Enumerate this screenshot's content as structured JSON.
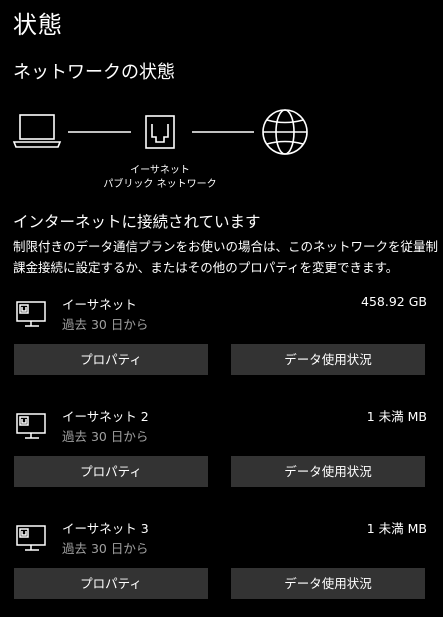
{
  "page": {
    "title": "状態",
    "section_title": "ネットワークの状態"
  },
  "diagram": {
    "adapter_label_line1": "イーサネット",
    "adapter_label_line2": "パブリック ネットワーク",
    "icons": [
      "laptop-icon",
      "ethernet-port-icon",
      "globe-icon"
    ]
  },
  "status": {
    "heading": "インターネットに接続されています",
    "description": "制限付きのデータ通信プランをお使いの場合は、このネットワークを従量制課金接続に設定するか、またはその他のプロパティを変更できます。"
  },
  "adapters": [
    {
      "name": "イーサネット",
      "period": "過去 30 日から",
      "usage": "458.92 GB",
      "properties_label": "プロパティ",
      "data_usage_label": "データ使用状況",
      "icon": "ethernet-adapter-icon"
    },
    {
      "name": "イーサネット 2",
      "period": "過去 30 日から",
      "usage": "1 未満 MB",
      "properties_label": "プロパティ",
      "data_usage_label": "データ使用状況",
      "icon": "ethernet-adapter-icon"
    },
    {
      "name": "イーサネット 3",
      "period": "過去 30 日から",
      "usage": "1 未満 MB",
      "properties_label": "プロパティ",
      "data_usage_label": "データ使用状況",
      "icon": "ethernet-adapter-icon"
    }
  ]
}
